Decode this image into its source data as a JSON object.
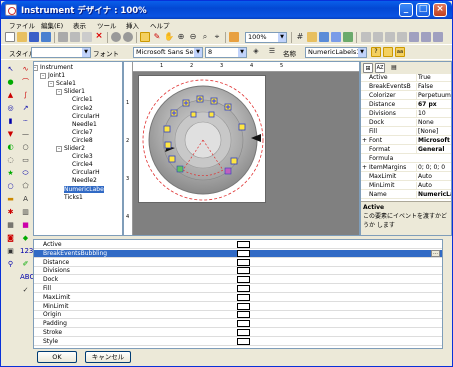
{
  "window": {
    "title": "Instrument デザイナ : 100%"
  },
  "menu": [
    "ファイル",
    "編集(E)",
    "表示",
    "ツール",
    "挿入",
    "ヘルプ"
  ],
  "toolbar2": {
    "style_label": "スタイル",
    "font_label": "フォント",
    "font_value": "Microsoft Sans Ser",
    "size_value": "8",
    "name_label": "名称",
    "name_value": "NumericLabels1",
    "zoom_value": "100%"
  },
  "tree": {
    "nodes": [
      {
        "label": "Instrument",
        "level": 0,
        "exp": "-"
      },
      {
        "label": "Joint1",
        "level": 1,
        "exp": "-"
      },
      {
        "label": "Scale1",
        "level": 2,
        "exp": "-"
      },
      {
        "label": "Slider1",
        "level": 3,
        "exp": "-"
      },
      {
        "label": "Circle1",
        "level": 4,
        "exp": ""
      },
      {
        "label": "Circle2",
        "level": 4,
        "exp": ""
      },
      {
        "label": "CircularH",
        "level": 4,
        "exp": ""
      },
      {
        "label": "Needle1",
        "level": 4,
        "exp": ""
      },
      {
        "label": "Circle7",
        "level": 4,
        "exp": ""
      },
      {
        "label": "Circle8",
        "level": 4,
        "exp": ""
      },
      {
        "label": "Slider2",
        "level": 3,
        "exp": "-"
      },
      {
        "label": "Circle3",
        "level": 4,
        "exp": ""
      },
      {
        "label": "Circle4",
        "level": 4,
        "exp": ""
      },
      {
        "label": "CircularH",
        "level": 4,
        "exp": ""
      },
      {
        "label": "Needle2",
        "level": 4,
        "exp": ""
      },
      {
        "label": "NumericLabe",
        "level": 3,
        "exp": "",
        "selected": true
      },
      {
        "label": "Ticks1",
        "level": 3,
        "exp": ""
      }
    ]
  },
  "ruler": {
    "h": [
      "1",
      "2",
      "3",
      "4",
      "5"
    ],
    "v": [
      "1",
      "2",
      "3",
      "4"
    ]
  },
  "props": {
    "rows": [
      {
        "name": "Active",
        "value": "True"
      },
      {
        "name": "BreakEventsB",
        "value": "False"
      },
      {
        "name": "Colorizer",
        "value": "PerpetuumS"
      },
      {
        "name": "Distance",
        "value": "67 px",
        "bold": true
      },
      {
        "name": "Divisions",
        "value": "10"
      },
      {
        "name": "Dock",
        "value": "None"
      },
      {
        "name": "Fill",
        "value": "[None]"
      },
      {
        "name": "Font",
        "value": "Microsoft",
        "bold": true,
        "exp": "+"
      },
      {
        "name": "Format",
        "value": "General",
        "bold": true
      },
      {
        "name": "Formula",
        "value": ""
      },
      {
        "name": "ItemMargins",
        "value": "0; 0; 0; 0",
        "exp": "+"
      },
      {
        "name": "MaxLimit",
        "value": "Auto"
      },
      {
        "name": "MinLimit",
        "value": "Auto"
      },
      {
        "name": "Name",
        "value": "NumericLa",
        "bold": true
      }
    ],
    "desc_title": "Active",
    "desc_text": "この要素にイベントを渡すかどうか します"
  },
  "bottom_rows": [
    {
      "name": "Active"
    },
    {
      "name": "BreakEventsBubbling",
      "selected": true
    },
    {
      "name": "Distance"
    },
    {
      "name": "Divisions"
    },
    {
      "name": "Dock"
    },
    {
      "name": "Fill"
    },
    {
      "name": "MaxLimit"
    },
    {
      "name": "MinLimit"
    },
    {
      "name": "Origin"
    },
    {
      "name": "Padding"
    },
    {
      "name": "Stroke"
    },
    {
      "name": "Style"
    }
  ],
  "buttons": {
    "ok": "OK",
    "cancel": "キャンセル"
  }
}
